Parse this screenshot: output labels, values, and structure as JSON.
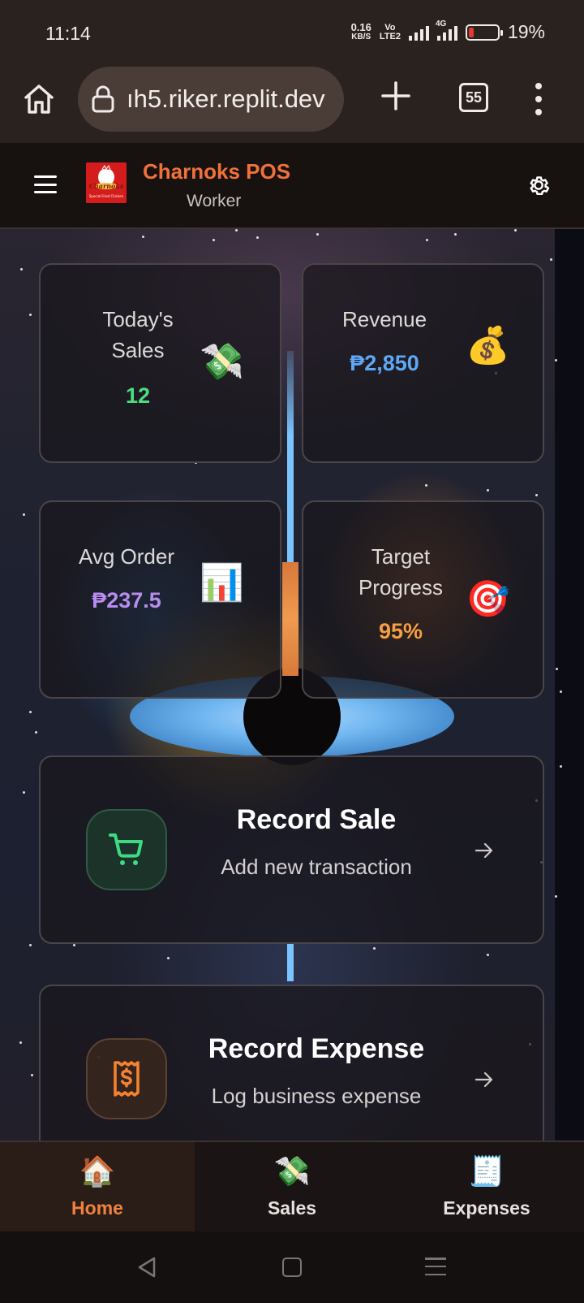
{
  "status_bar": {
    "time": "11:14",
    "net_speed_value": "0.16",
    "net_speed_unit": "KB/S",
    "volte_top": "Vo",
    "volte_bottom": "LTE2",
    "network": "4G",
    "battery_percent": "19%",
    "battery_level": 0.19
  },
  "browser": {
    "url": "ıh5.riker.replit.dev",
    "tab_count": "55",
    "icons": [
      "home-icon",
      "lock-icon",
      "plus-icon",
      "tabs-icon",
      "more-vert-icon"
    ]
  },
  "header": {
    "app_name": "Charnoks POS",
    "role": "Worker",
    "logo_text": "Charnoks",
    "logo_tagline": "Special Fried Chicken",
    "icons": [
      "menu-icon",
      "settings-gear-icon"
    ]
  },
  "stats": [
    {
      "label": "Today's Sales",
      "label_line1": "Today's",
      "label_line2": "Sales",
      "value": "12",
      "color": "#4ade80",
      "emoji": "💸"
    },
    {
      "label": "Revenue",
      "value": "₱2,850",
      "color": "#5ea8f5",
      "emoji": "💰"
    },
    {
      "label": "Avg Order",
      "value": "₱237.5",
      "color": "#b98cf0",
      "emoji": "📊"
    },
    {
      "label": "Target Progress",
      "label_line1": "Target",
      "label_line2": "Progress",
      "value": "95%",
      "color": "#f59e42",
      "emoji": "🎯"
    }
  ],
  "actions": [
    {
      "title": "Record Sale",
      "subtitle": "Add new transaction",
      "icon": "shopping-cart-icon",
      "accent": "#3ddc84"
    },
    {
      "title": "Record Expense",
      "subtitle": "Log business expense",
      "icon": "receipt-dollar-icon",
      "accent": "#f5822f"
    }
  ],
  "bottom_nav": [
    {
      "label": "Home",
      "emoji": "🏠",
      "active": true
    },
    {
      "label": "Sales",
      "emoji": "💸",
      "active": false
    },
    {
      "label": "Expenses",
      "emoji": "🧾",
      "active": false
    }
  ],
  "system_nav": [
    "back-icon",
    "home-square-icon",
    "recents-menu-icon"
  ]
}
